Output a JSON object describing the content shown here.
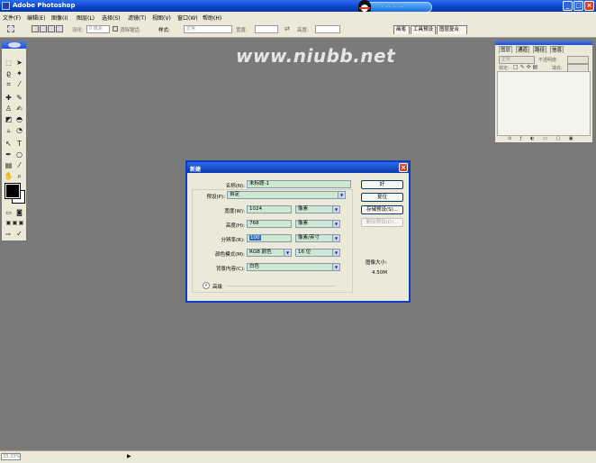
{
  "titlebar": {
    "title": "Adobe Photoshop",
    "qq_dots": "·· ·· ·· ··"
  },
  "menu": [
    "文件(F)",
    "编辑(E)",
    "图像(I)",
    "图层(L)",
    "选择(S)",
    "滤镜(T)",
    "视图(V)",
    "窗口(W)",
    "帮助(H)"
  ],
  "options": {
    "feather_label": "羽化:",
    "feather_value": "0 像素",
    "antialias_label": "消除锯齿",
    "style_label": "样式:",
    "style_value": "正常",
    "width_label": "宽度:",
    "height_label": "高度:"
  },
  "palette_well": [
    "画笔",
    "工具预设",
    "图层复合"
  ],
  "layers_panel": {
    "tabs": [
      "图层",
      "通道",
      "路径",
      "信息"
    ],
    "blend_mode": "正常",
    "opacity_label": "不透明度:",
    "lock_label": "锁定:",
    "fill_label": "填充:"
  },
  "watermark": "www.niubb.net",
  "dialog": {
    "title": "新建",
    "name_label": "名称(N):",
    "name_value": "未标题-1",
    "preset_label": "预设(P):",
    "preset_value": "自定",
    "width_label": "宽度(W):",
    "width_value": "1024",
    "width_unit": "像素",
    "height_label": "高度(H):",
    "height_value": "768",
    "height_unit": "像素",
    "resolution_label": "分辨率(R):",
    "resolution_value": "100",
    "resolution_unit": "像素/英寸",
    "colormode_label": "颜色模式(M):",
    "colormode_value": "RGB 颜色",
    "bitdepth_value": "16 位",
    "background_label": "背景内容(C):",
    "background_value": "白色",
    "advanced_label": "高级",
    "ok_button": "好",
    "reset_button": "复位",
    "save_preset_button": "存储预设(S)...",
    "delete_preset_button": "删除预设(D)...",
    "image_size_label": "图像大小:",
    "image_size_value": "4.50M"
  },
  "statusbar": {
    "zoom": "33.33%",
    "arrow": "▶"
  }
}
